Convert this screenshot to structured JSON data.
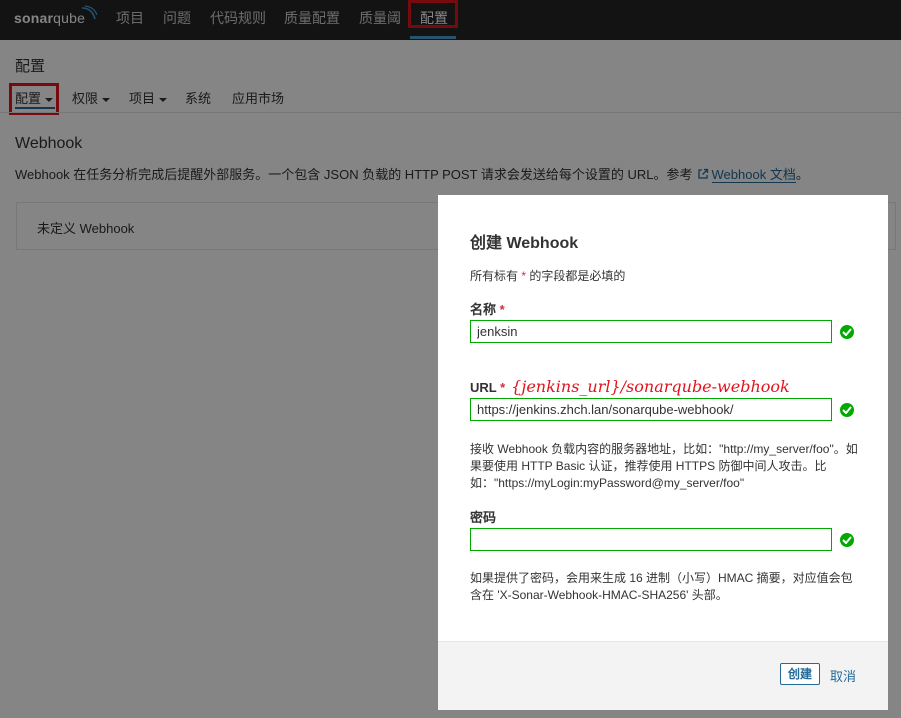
{
  "topnav": {
    "logo_main": "sonar",
    "logo_sub": "qube",
    "items": [
      "项目",
      "问题",
      "代码规则",
      "质量配置",
      "质量阈",
      "配置"
    ],
    "active_index": 5
  },
  "page": {
    "title": "配置",
    "subnav": [
      "配置",
      "权限",
      "项目",
      "系统",
      "应用市场"
    ]
  },
  "section": {
    "title": "Webhook",
    "description": "Webhook 在任务分析完成后提醒外部服务。一个包含 JSON 负载的 HTTP POST 请求会发送给每个设置的 URL。参考",
    "doc_link": "Webhook 文档",
    "description_end": "。",
    "empty_text": "未定义 Webhook"
  },
  "modal": {
    "title": "创建 Webhook",
    "required_note_prefix": "所有标有",
    "required_star": "*",
    "required_note_suffix": "的字段都是必填的",
    "name_label": "名称",
    "name_value": "jenksin",
    "url_label": "URL",
    "url_annotation": "{jenkins_url}/sonarqube-webhook",
    "url_value": "https://jenkins.zhch.lan/sonarqube-webhook/",
    "url_help": "接收 Webhook 负载内容的服务器地址，比如：\"http://my_server/foo\"。如果要使用 HTTP Basic 认证，推荐使用 HTTPS 防御中间人攻击。比如：\"https://myLogin:myPassword@my_server/foo\"",
    "secret_label": "密码",
    "secret_value": "",
    "secret_help": "如果提供了密码，会用来生成 16 进制（小写）HMAC 摘要，对应值会包含在 'X-Sonar-Webhook-HMAC-SHA256' 头部。",
    "create_label": "创建",
    "cancel_label": "取消"
  },
  "colors": {
    "topbar": "#262626",
    "accent": "#236a97",
    "valid": "#00aa00",
    "highlight": "#e0141e"
  },
  "icons": [
    "sonarqube-logo-icon",
    "caret-down-icon",
    "external-link-icon",
    "check-circle-icon"
  ]
}
